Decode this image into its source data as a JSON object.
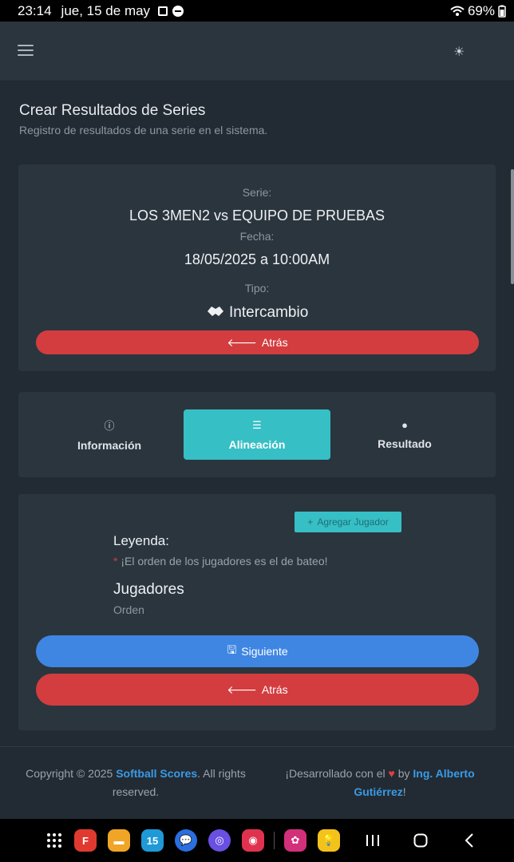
{
  "status_bar": {
    "time": "23:14",
    "date": "jue, 15 de may",
    "battery": "69%"
  },
  "page": {
    "title": "Crear Resultados de Series",
    "subtitle": "Registro de resultados de una serie en el sistema."
  },
  "serie_card": {
    "serie_label": "Serie:",
    "serie_value": "LOS 3MEN2 vs EQUIPO DE PRUEBAS",
    "fecha_label": "Fecha:",
    "fecha_value": "18/05/2025 a 10:00AM",
    "tipo_label": "Tipo:",
    "tipo_value": "Intercambio",
    "back_label": "Atrás"
  },
  "tabs": [
    {
      "label": "Información",
      "icon": "info-icon"
    },
    {
      "label": "Alineación",
      "icon": "list-icon",
      "active": true
    },
    {
      "label": "Resultado",
      "icon": "lightbulb-icon"
    }
  ],
  "lineup": {
    "add_player_label": "Agregar Jugador",
    "legend_title": "Leyenda:",
    "legend_asterisk": "*",
    "legend_text": "¡El orden de los jugadores es el de bateo!",
    "players_title": "Jugadores",
    "order_label": "Orden",
    "next_label": "Siguiente",
    "back_label": "Atrás"
  },
  "footer": {
    "copyright_prefix": "Copyright © 2025 ",
    "brand": "Softball Scores",
    "copyright_suffix": ". All rights reserved.",
    "dev_prefix": "¡Desarrollado con el ",
    "dev_by": " by ",
    "author": "Ing. Alberto Gutiérrez",
    "dev_suffix": "!"
  },
  "colors": {
    "accent": "#36bfc5",
    "danger": "#d33d3f",
    "primary": "#3f86e3",
    "link": "#3b9ae6"
  }
}
